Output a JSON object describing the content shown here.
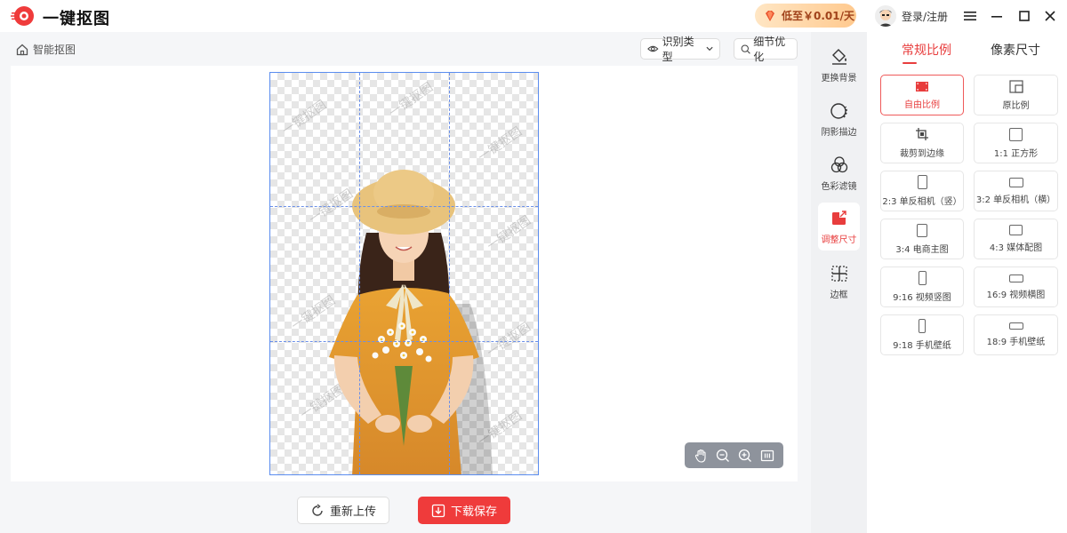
{
  "app": {
    "title": "一键抠图"
  },
  "header": {
    "promo_text": "低至￥0.01/天",
    "login_text": "登录/注册"
  },
  "toolbar": {
    "breadcrumb": "智能抠图",
    "recognize_type": "识别类型",
    "detail_optimize": "细节优化"
  },
  "canvas": {
    "watermark": "一键抠图"
  },
  "bottom": {
    "reupload": "重新上传",
    "save": "下载保存"
  },
  "tools": [
    {
      "label": "更换背景",
      "icon": "paint-bucket-icon"
    },
    {
      "label": "阴影描边",
      "icon": "shadow-circle-icon"
    },
    {
      "label": "色彩滤镜",
      "icon": "color-filter-icon"
    },
    {
      "label": "调整尺寸",
      "icon": "resize-icon",
      "active": true
    },
    {
      "label": "边框",
      "icon": "border-grid-icon"
    }
  ],
  "tabs": [
    {
      "label": "常规比例",
      "active": true
    },
    {
      "label": "像素尺寸",
      "active": false
    }
  ],
  "ratios": [
    {
      "label": "自由比例",
      "active": true
    },
    {
      "label": "原比例"
    },
    {
      "label": "裁剪到边缘"
    },
    {
      "label": "1:1 正方形"
    },
    {
      "label": "2:3 单反相机（竖）"
    },
    {
      "label": "3:2 单反相机（横）"
    },
    {
      "label": "3:4 电商主图"
    },
    {
      "label": "4:3 媒体配图"
    },
    {
      "label": "9:16 视频竖图"
    },
    {
      "label": "16:9 视频横图"
    },
    {
      "label": "9:18 手机壁纸"
    },
    {
      "label": "18:9 手机壁纸"
    }
  ],
  "colors": {
    "accent": "#e83d3d",
    "grid": "#5b8def"
  }
}
